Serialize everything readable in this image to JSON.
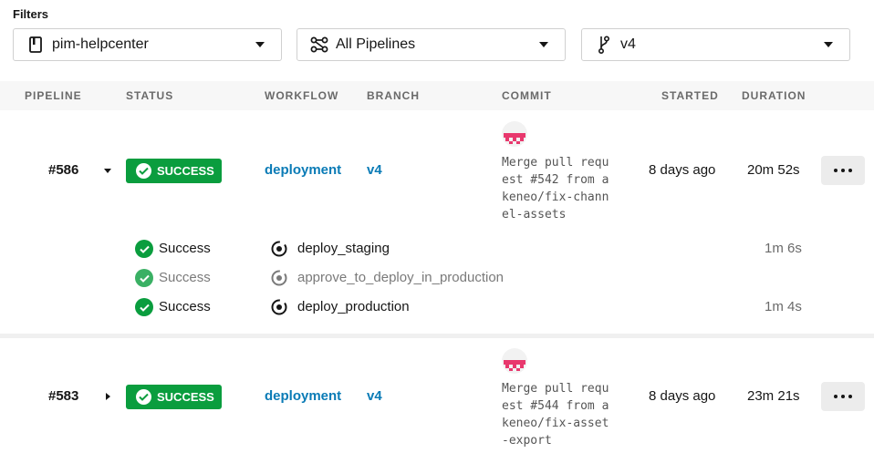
{
  "filters": {
    "title": "Filters",
    "project": {
      "value": "pim-helpcenter",
      "icon": "repo-icon"
    },
    "pipelines": {
      "value": "All Pipelines",
      "icon": "pipelines-icon"
    },
    "branch": {
      "value": "v4",
      "icon": "branch-icon"
    }
  },
  "table": {
    "headers": {
      "pipeline": "PIPELINE",
      "status": "STATUS",
      "workflow": "WORKFLOW",
      "branch": "BRANCH",
      "commit": "COMMIT",
      "started": "STARTED",
      "duration": "DURATION"
    },
    "rows": [
      {
        "number": "#586",
        "expanded": true,
        "status": "SUCCESS",
        "workflow": "deployment",
        "branch": "v4",
        "commit_lines": [
          "Merge pull requ",
          "est #542 from a",
          "keneo/fix-chann",
          "el-assets"
        ],
        "started": "8 days ago",
        "duration": "20m 52s",
        "jobs": [
          {
            "status": "Success",
            "name": "deploy_staging",
            "duration": "1m 6s",
            "type": "job"
          },
          {
            "status": "Success",
            "name": "approve_to_deploy_in_production",
            "duration": "",
            "type": "approval"
          },
          {
            "status": "Success",
            "name": "deploy_production",
            "duration": "1m 4s",
            "type": "job"
          }
        ]
      },
      {
        "number": "#583",
        "expanded": false,
        "status": "SUCCESS",
        "workflow": "deployment",
        "branch": "v4",
        "commit_lines": [
          "Merge pull requ",
          "est #544 from a",
          "keneo/fix-asset",
          "-export"
        ],
        "started": "8 days ago",
        "duration": "23m 21s"
      }
    ]
  },
  "colors": {
    "success": "#0a9d3e",
    "link": "#0a7bb6",
    "avatar": "#e8386d"
  }
}
